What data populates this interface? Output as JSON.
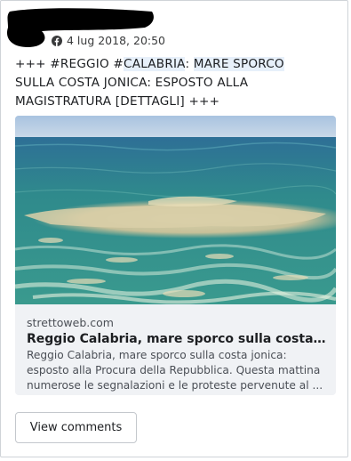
{
  "post": {
    "timestamp": "4 lug 2018, 20:50",
    "source_icon": "facebook-icon",
    "text_parts": {
      "a": "+++ #REGGIO #",
      "b": "CALABRIA",
      "c": ": ",
      "d": "MARE SPORCO",
      "e": " SULLA COSTA JONICA: ESPOSTO ALLA MAGISTRATURA [DETTAGLI] +++"
    }
  },
  "link": {
    "image_alt": "sea-photo",
    "domain": "strettoweb.com",
    "title": "Reggio Calabria, mare sporco sulla costa jonica: esposto alla Procura della Repubblica",
    "description": "Reggio Calabria, mare sporco sulla costa jonica: esposto alla Procura della Repubblica. Questa mattina numerose le segnalazioni e le proteste pervenute al Palazzo Municipale ..."
  },
  "actions": {
    "view_comments": "View comments"
  },
  "colors": {
    "highlight": "#e7f0fa",
    "sea": "#2f8a8c",
    "foam": "#d9cfa8"
  }
}
